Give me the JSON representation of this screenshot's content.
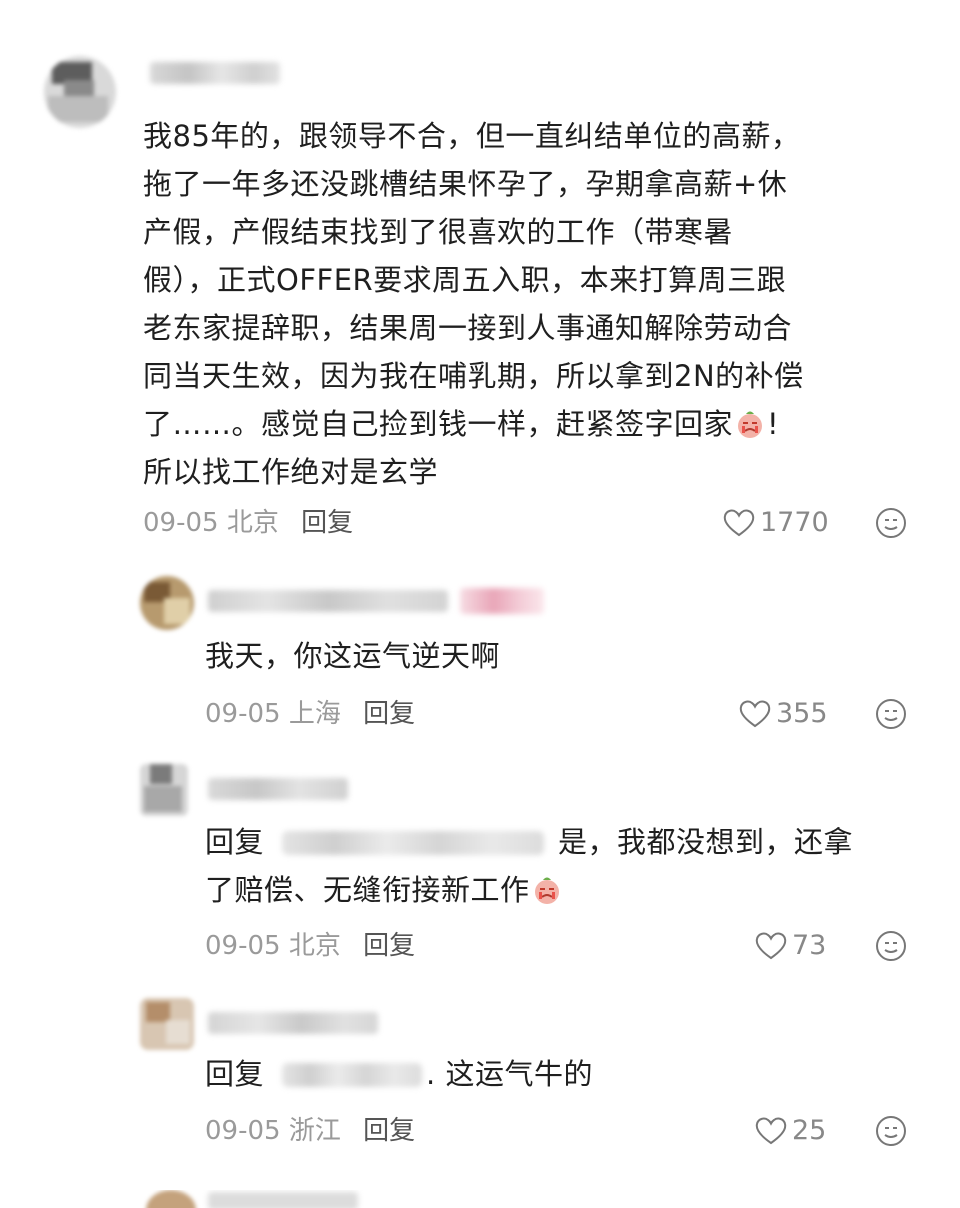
{
  "comments": [
    {
      "text": "我85年的，跟领导不合，但一直纠结单位的高薪，\n拖了一年多还没跳槽结果怀孕了，孕期拿高薪+休\n产假，产假结束找到了很喜欢的工作（带寒暑\n假），正式OFFER要求周五入职，本来打算周三跟\n老东家提辞职，结果周一接到人事通知解除劳动合\n同当天生效，因为我在哺乳期，所以拿到2N的补偿\n了……。感觉自己捡到钱一样，赶紧签字回家",
      "text_tail": "!\n所以找工作绝对是玄学",
      "date": "09-05",
      "location": "北京",
      "reply_label": "回复",
      "likes": "1770"
    },
    {
      "text": "我天，你这运气逆天啊",
      "date": "09-05",
      "location": "上海",
      "reply_label": "回复",
      "likes": "355"
    },
    {
      "reply_prefix": "回复",
      "text_after_mention": "是，我都没想到，还拿",
      "text_line2": "了赔偿、无缝衔接新工作",
      "date": "09-05",
      "location": "北京",
      "reply_label": "回复",
      "likes": "73"
    },
    {
      "reply_prefix": "回复",
      "text_after_mention": ". 这运气牛的",
      "date": "09-05",
      "location": "浙江",
      "reply_label": "回复",
      "likes": "25"
    }
  ],
  "icons": {
    "like": "heart-outline-icon",
    "emoji": "smiley-face-icon",
    "inline_emoji": "crying-peach-emoji"
  },
  "colors": {
    "text": "#1f1f1f",
    "meta": "#9a9a9a",
    "reply_link": "#555555",
    "like": "#888888"
  }
}
